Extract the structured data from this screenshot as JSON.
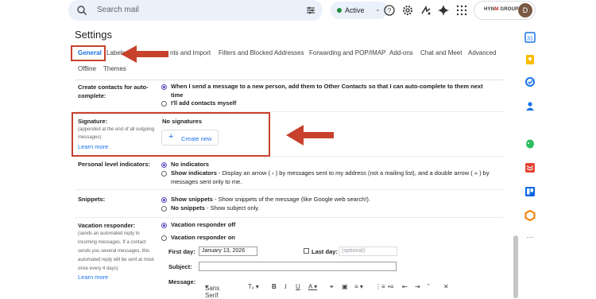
{
  "search": {
    "placeholder": "Search mail"
  },
  "status": {
    "label": "Active"
  },
  "account": {
    "brand_prefix": "HYN",
    "brand_mark": "M",
    "brand_suffix": " GROUP",
    "avatar_letter": "D"
  },
  "settings": {
    "title": "Settings",
    "tabs": [
      {
        "label": "General",
        "active": true
      },
      {
        "label": "Labels"
      },
      {
        "label": "nts and Import"
      },
      {
        "label": "Filters and Blocked Addresses"
      },
      {
        "label": "Forwarding and POP/IMAP"
      },
      {
        "label": "Add-ons"
      },
      {
        "label": "Chat and Meet"
      },
      {
        "label": "Advanced"
      },
      {
        "label": "Offline"
      },
      {
        "label": "Themes"
      }
    ]
  },
  "create_contacts": {
    "label": "Create contacts for auto-complete:",
    "label_line1": "Create contacts for auto-",
    "label_line2": "complete:",
    "option1_line1": "When I send a message to a new person, add them to Other Contacts so that I can auto-complete to them next",
    "option1_line2": "time",
    "option2": "I'll add contacts myself"
  },
  "signature": {
    "label": "Signature:",
    "sub_line1": "(appended at the end of all outgoing",
    "sub_line2": "messages)",
    "learn_more": "Learn more",
    "status": "No signatures",
    "create_new": "Create new"
  },
  "personal_indicators": {
    "label": "Personal level indicators:",
    "option1": "No indicators",
    "option2_bold": "Show indicators",
    "option2_line1": " - Display an arrow ( › ) by messages sent to my address (not a mailing list), and a double arrow ( » ) by",
    "option2_line2": "messages sent only to me."
  },
  "snippets": {
    "label": "Snippets:",
    "option1_bold": "Show snippets",
    "option1_rest": " - Show snippets of the message (like Google web search!).",
    "option2_bold": "No snippets",
    "option2_rest": " - Show subject only."
  },
  "vacation": {
    "label": "Vacation responder:",
    "sub_lines": [
      "(sends an automated reply to",
      "incoming messages. If a contact",
      "sends you several messages, this",
      "automated reply will be sent at most",
      "once every 4 days)"
    ],
    "learn_more": "Learn more",
    "option1": "Vacation responder off",
    "option2": "Vacation responder on",
    "first_day_label": "First day:",
    "first_day_value": "January 13, 2026",
    "last_day_label": "Last day:",
    "last_day_placeholder": "(optional)",
    "subject_label": "Subject:",
    "message_label": "Message:",
    "font_name": "Sans Serif"
  },
  "toolbar_icons": [
    "search-icon",
    "filter-icon",
    "help-icon",
    "gear-icon",
    "sparkle-icon",
    "gemini-icon",
    "apps-icon"
  ],
  "side_apps": [
    "calendar-app-icon",
    "keep-app-icon",
    "tasks-app-icon",
    "contacts-app-icon",
    "evernote-app-icon",
    "todoist-app-icon",
    "trello-app-icon",
    "orange-app-icon",
    "more-icon"
  ],
  "colors": {
    "accent": "#1a73e8",
    "annotation": "#c8412d",
    "radio": "#5e4bbd"
  }
}
